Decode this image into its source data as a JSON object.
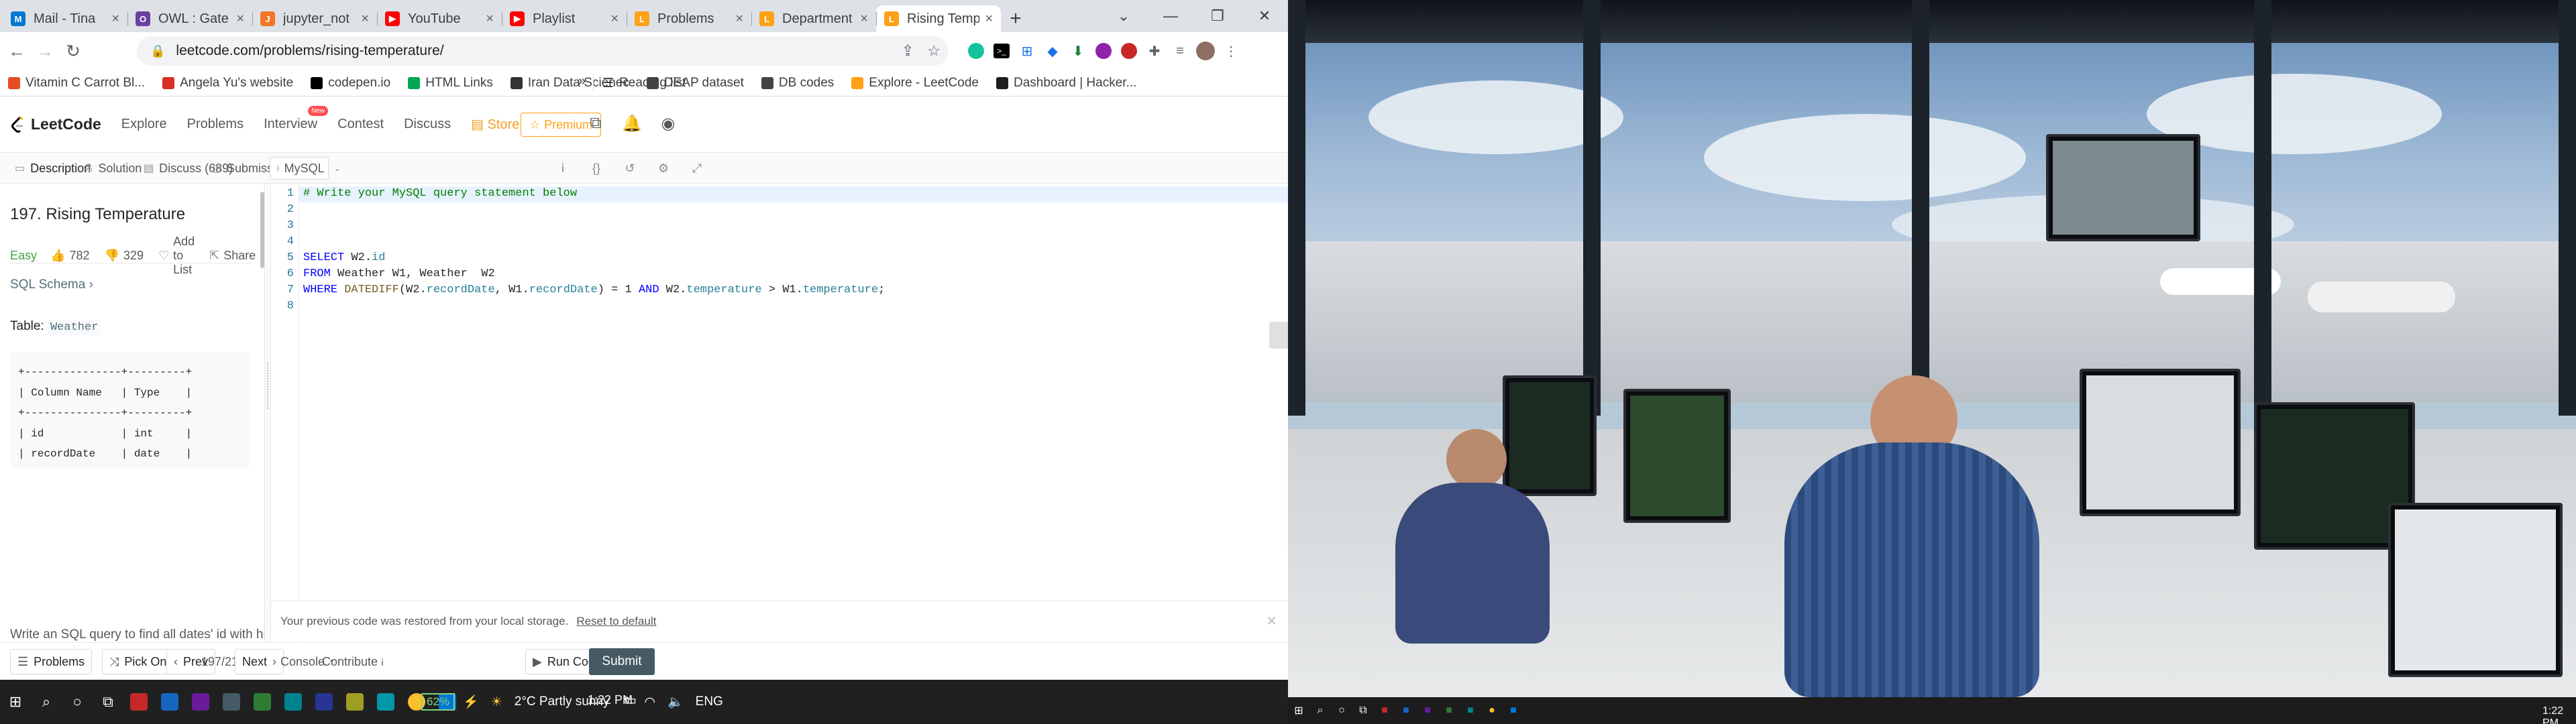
{
  "browser": {
    "tabs": [
      {
        "title": "Mail - Tina",
        "color": "#0078d4",
        "glyph": "M"
      },
      {
        "title": "OWL : Gate",
        "color": "#6b3fa0",
        "glyph": "O"
      },
      {
        "title": "jupyter_not",
        "color": "#f37726",
        "glyph": "J"
      },
      {
        "title": "YouTube",
        "color": "#ff0000",
        "glyph": "▶"
      },
      {
        "title": "Playlist",
        "color": "#ff0000",
        "glyph": "▶"
      },
      {
        "title": "Problems",
        "color": "#ffa116",
        "glyph": "L"
      },
      {
        "title": "Department",
        "color": "#ffa116",
        "glyph": "L"
      },
      {
        "title": "Rising Temp",
        "color": "#ffa116",
        "glyph": "L"
      }
    ],
    "url": "leetcode.com/problems/rising-temperature/",
    "bookmarks": [
      {
        "label": "Vitamin C Carrot Bl...",
        "color": "#e44d26"
      },
      {
        "label": "Angela Yu's website",
        "color": "#d93025"
      },
      {
        "label": "codepen.io",
        "color": "#000000"
      },
      {
        "label": "HTML Links",
        "color": "#00a651"
      },
      {
        "label": "Iran Data Scienec",
        "color": "#333333"
      },
      {
        "label": "DEAP dataset",
        "color": "#444444"
      },
      {
        "label": "DB codes",
        "color": "#444444"
      },
      {
        "label": "Explore - LeetCode",
        "color": "#ffa116"
      },
      {
        "label": "Dashboard | Hacker...",
        "color": "#1f1f1f"
      }
    ],
    "bookmarks_more": "»",
    "reading_list": "Reading list"
  },
  "leetcode": {
    "logo": "LeetCode",
    "nav": [
      "Explore",
      "Problems",
      "Interview",
      "Contest",
      "Discuss",
      "Store"
    ],
    "new_badge": "New",
    "premium": "Premium",
    "subtabs": {
      "description": "Description",
      "solution": "Solution",
      "discuss": "Discuss (689)",
      "submissions": "Submissions"
    },
    "language": "MySQL",
    "problem": {
      "title": "197. Rising Temperature",
      "difficulty": "Easy",
      "likes": "782",
      "dislikes": "329",
      "add_to_list": "Add to List",
      "share": "Share",
      "schema_link": "SQL Schema ›",
      "table_label": "Table:",
      "table_name": "Weather",
      "schema_text": "+---------------+---------+\n| Column Name   | Type    |\n+---------------+---------+\n| id            | int     |\n| recordDate    | date    |\n| temperature   | int     |\n+---------------+---------+\nid is the primary key for this table.\nThis table contains information about the temperature on a\ncertain day.",
      "cut_text": "Write an SQL query to find all dates' id with higher temperature compared"
    },
    "editor": {
      "line_numbers": [
        "1",
        "2",
        "3",
        "4",
        "5",
        "6",
        "7",
        "8"
      ],
      "comment": "# Write your MySQL query statement below",
      "line4": {
        "kw": "SELECT",
        "rest_a": " W2.",
        "col": "id"
      },
      "line5": {
        "kw": "FROM",
        "rest": " Weather W1, Weather  W2"
      },
      "line6": {
        "kw1": "WHERE",
        "fn": " DATEDIFF",
        "p1": "(W2.",
        "c1": "recordDate",
        "p2": ", W1.",
        "c2": "recordDate",
        "p3": ") = 1 ",
        "kw2": "AND",
        "p4": " W2.",
        "c3": "temperature",
        "p5": " > W1.",
        "c4": "temperature",
        "p6": ";"
      }
    },
    "restore_msg": "Your previous code was restored from your local storage.",
    "reset_link": "Reset to default",
    "bottom": {
      "problems": "Problems",
      "pick_one": "Pick One",
      "prev": "Prev",
      "page": "197/2157",
      "next": "Next",
      "console": "Console",
      "contribute": "Contribute",
      "run_code": "Run Code",
      "submit": "Submit"
    }
  },
  "taskbar": {
    "battery": "62%",
    "weather": "2°C  Partly sunny",
    "lang": "ENG",
    "time": "1:22 PM"
  },
  "second_monitor": {
    "time": "1:22 PM"
  }
}
